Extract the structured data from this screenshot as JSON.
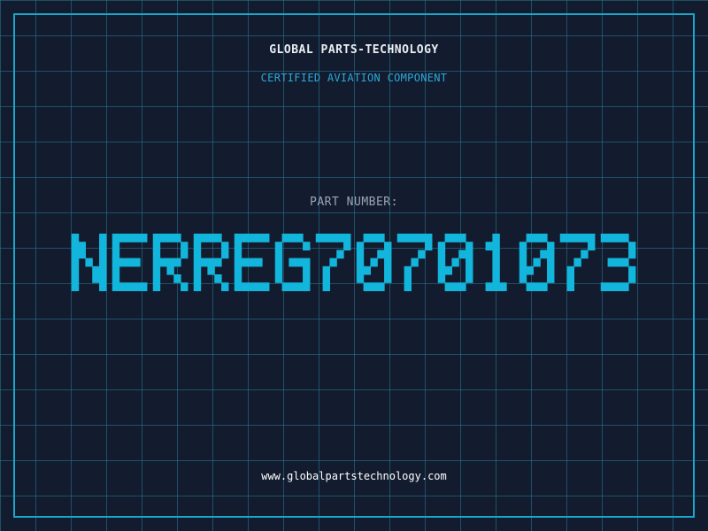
{
  "header": {
    "company": "GLOBAL PARTS-TECHNOLOGY",
    "tagline": "CERTIFIED AVIATION COMPONENT"
  },
  "part": {
    "label": "PART NUMBER:",
    "number": "NERREG70701073",
    "color": "#12b5db"
  },
  "footer": {
    "website": "www.globalpartstechnology.com"
  },
  "colors": {
    "background": "#131c2f",
    "grid": "#28789a",
    "frame": "#1aa6c9",
    "accent": "#2aa9d8"
  }
}
